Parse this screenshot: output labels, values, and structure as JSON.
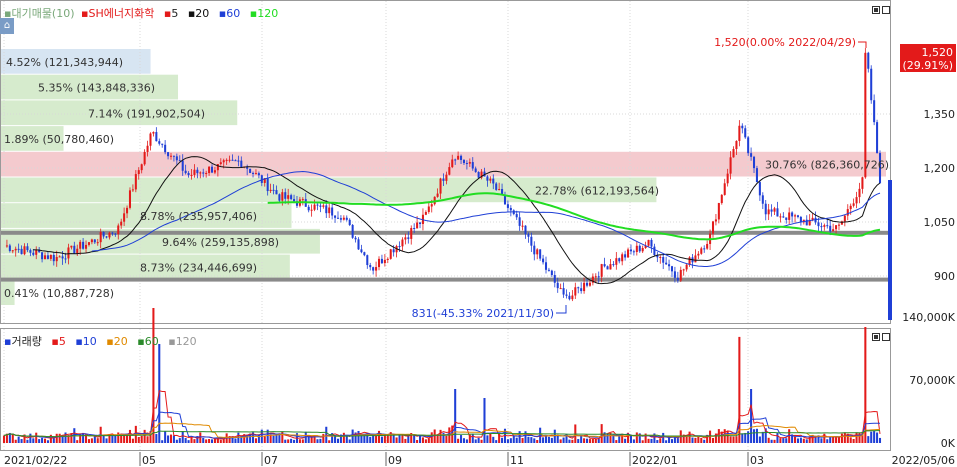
{
  "price_panel": {
    "legend": {
      "vp_label": "▪대기매물(10)",
      "series_label": "SH에너지화학",
      "ma5": "5",
      "ma20": "20",
      "ma60": "60",
      "ma120": "120"
    },
    "current_price_tag": "1,520",
    "current_change_tag": "(29.91%)",
    "max_annotation": "1,520(0.00% 2022/04/29)",
    "min_annotation": "831(-45.33% 2021/11/30)",
    "y_ticks": [
      "1,350",
      "1,200",
      "1,050",
      "900"
    ],
    "volume_profile": [
      {
        "label": "4.52% (121,343,944)",
        "pct": 4.52
      },
      {
        "label": "5.35% (143,848,336)",
        "pct": 5.35
      },
      {
        "label": "7.14% (191,902,504)",
        "pct": 7.14
      },
      {
        "label": "1.89% (50,780,460)",
        "pct": 1.89
      },
      {
        "label": "30.76% (826,360,726)",
        "pct": 30.76,
        "highlight": true
      },
      {
        "label": "22.78% (612,193,564)",
        "pct": 22.78
      },
      {
        "label": "8.78% (235,957,406)",
        "pct": 8.78
      },
      {
        "label": "9.64% (259,135,898)",
        "pct": 9.64
      },
      {
        "label": "8.73% (234,446,699)",
        "pct": 8.73
      },
      {
        "label": "0.41% (10,887,728)",
        "pct": 0.41
      }
    ]
  },
  "volume_panel": {
    "legend": {
      "title": "거래량",
      "ma5": "5",
      "ma10": "10",
      "ma20": "20",
      "ma60": "60",
      "ma120": "120"
    },
    "y_ticks": [
      "140,000K",
      "70,000K",
      "0K"
    ]
  },
  "x_axis": {
    "ticks": [
      "2021/02/22",
      "05",
      "07",
      "09",
      "11",
      "2022/01",
      "03",
      "2022/05/06"
    ]
  },
  "colors": {
    "up": "#e31a1a",
    "down": "#1f3fd6",
    "ma5": "#e31a1a",
    "ma20": "#111111",
    "ma60": "#1f3fd6",
    "ma120": "#22dd22",
    "vp_fill": "#cfe8c4",
    "vp_highlight": "#f2c1c5",
    "vp_top": "#d0e0f0"
  },
  "chart_data": {
    "type": "candlestick",
    "title": "SH에너지화학",
    "x_range": [
      "2021/02/22",
      "2022/05/06"
    ],
    "ylim": [
      810,
      1560
    ],
    "key_points": [
      {
        "date": "2021/02/22",
        "close": 985
      },
      {
        "date": "2021/03/20",
        "close": 950
      },
      {
        "date": "2021/04/20",
        "close": 1030
      },
      {
        "date": "2021/05/07",
        "close": 1300
      },
      {
        "date": "2021/05/25",
        "close": 1180
      },
      {
        "date": "2021/06/20",
        "close": 1220
      },
      {
        "date": "2021/07/10",
        "close": 1120
      },
      {
        "date": "2021/08/10",
        "close": 1070
      },
      {
        "date": "2021/08/25",
        "close": 920
      },
      {
        "date": "2021/09/20",
        "close": 1060
      },
      {
        "date": "2021/10/05",
        "close": 1240
      },
      {
        "date": "2021/10/25",
        "close": 1150
      },
      {
        "date": "2021/11/10",
        "close": 1010
      },
      {
        "date": "2021/11/30",
        "close": 831
      },
      {
        "date": "2021/12/20",
        "close": 930
      },
      {
        "date": "2022/01/10",
        "close": 990
      },
      {
        "date": "2022/01/25",
        "close": 900
      },
      {
        "date": "2022/02/10",
        "close": 1010
      },
      {
        "date": "2022/02/25",
        "close": 1320
      },
      {
        "date": "2022/03/10",
        "close": 1080
      },
      {
        "date": "2022/04/15",
        "close": 1030
      },
      {
        "date": "2022/04/28",
        "close": 1170
      },
      {
        "date": "2022/04/29",
        "close": 1520
      },
      {
        "date": "2022/05/06",
        "close": 1170
      }
    ],
    "overlay_levels": [
      1020,
      890
    ]
  }
}
